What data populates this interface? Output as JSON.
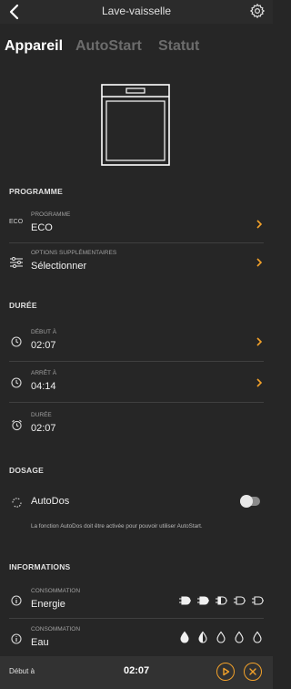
{
  "header": {
    "title": "Lave-vaisselle",
    "back_icon": "back-arrow-icon",
    "settings_icon": "gear-icon"
  },
  "tabs": [
    {
      "label": "Appareil",
      "active": true
    },
    {
      "label": "AutoStart",
      "active": false
    },
    {
      "label": "Statut",
      "active": false
    }
  ],
  "colors": {
    "accent": "#f2a12a",
    "background": "#262626"
  },
  "programme": {
    "title": "PROGRAMME",
    "program": {
      "lead": "ECO",
      "caption": "PROGRAMME",
      "value": "ECO"
    },
    "options": {
      "caption": "OPTIONS SUPPLÉMENTAIRES",
      "value": "Sélectionner"
    }
  },
  "duree": {
    "title": "DURÉE",
    "start": {
      "caption": "DÉBUT À",
      "value": "02:07"
    },
    "stop": {
      "caption": "ARRÊT À",
      "value": "04:14"
    },
    "duration": {
      "caption": "DURÉE",
      "value": "02:07"
    }
  },
  "dosage": {
    "title": "DOSAGE",
    "autodos": {
      "label": "AutoDos",
      "enabled": false
    },
    "note": "La fonction AutoDos doit être activée pour pouvoir utiliser AutoStart."
  },
  "informations": {
    "title": "INFORMATIONS",
    "energy": {
      "caption": "CONSOMMATION",
      "value": "Energie",
      "level_filled": 2,
      "level_half": 1,
      "level_total": 5
    },
    "water": {
      "caption": "CONSOMMATION",
      "value": "Eau",
      "level_filled": 1,
      "level_half": 1,
      "level_total": 5
    }
  },
  "footer": {
    "label": "Début à",
    "time": "02:07"
  }
}
